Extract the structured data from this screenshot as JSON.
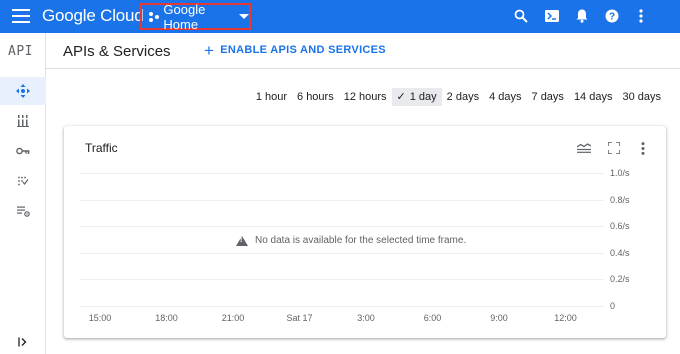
{
  "topbar": {
    "brand": "Google Cloud",
    "project": "Google Home",
    "icons": [
      "search-icon",
      "cloud-shell-icon",
      "notifications-icon",
      "help-icon",
      "more-vert-icon"
    ],
    "color": "#1a73e8"
  },
  "sidebar": {
    "logo": "API",
    "items": [
      {
        "icon": "enabled-apis-icon",
        "active": true
      },
      {
        "icon": "library-icon",
        "active": false
      },
      {
        "icon": "credentials-icon",
        "active": false
      },
      {
        "icon": "oauth-consent-icon",
        "active": false
      },
      {
        "icon": "page-usage-agreements-icon",
        "active": false
      }
    ],
    "collapse_icon": "expand-sidebar-icon"
  },
  "header": {
    "title": "APIs & Services",
    "enable_label": "ENABLE APIS AND SERVICES"
  },
  "time_ranges": [
    "1 hour",
    "6 hours",
    "12 hours",
    "1 day",
    "2 days",
    "4 days",
    "7 days",
    "14 days",
    "30 days"
  ],
  "selected_range": "1 day",
  "traffic_card": {
    "title": "Traffic",
    "no_data": "No data is available for the selected time frame.",
    "icons": [
      "legend-icon",
      "fullscreen-icon",
      "more-vert-icon"
    ]
  },
  "chart_data": {
    "type": "line",
    "title": "Traffic",
    "x_ticks": [
      "15:00",
      "18:00",
      "21:00",
      "Sat 17",
      "3:00",
      "6:00",
      "9:00",
      "12:00"
    ],
    "y_ticks": [
      "1.0/s",
      "0.8/s",
      "0.6/s",
      "0.4/s",
      "0.2/s",
      "0"
    ],
    "ylim": [
      0,
      1.0
    ],
    "series": [],
    "grid": true
  }
}
